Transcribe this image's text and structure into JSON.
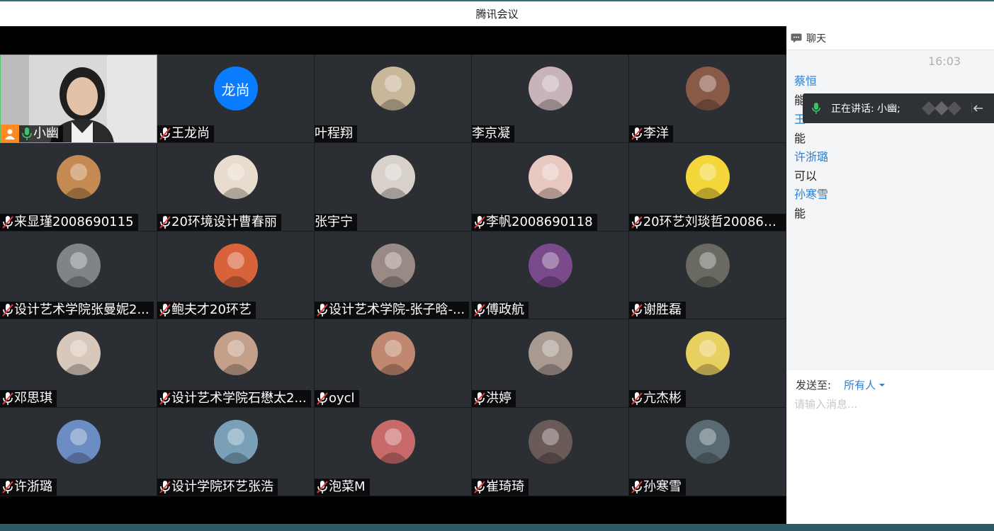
{
  "window": {
    "title": "腾讯会议"
  },
  "participants": [
    {
      "name": "小幽",
      "mic": "on",
      "host": true,
      "video": true
    },
    {
      "name": "王龙尚",
      "mic": "off",
      "avatar_text": "龙尚",
      "avatar_color": "#0a7cff"
    },
    {
      "name": "叶程翔",
      "mic": "none",
      "avatar_color": "#c9b79a"
    },
    {
      "name": "李京凝",
      "mic": "none",
      "avatar_color": "#c8b4b8"
    },
    {
      "name": "李洋",
      "mic": "off",
      "avatar_color": "#8a5a48"
    },
    {
      "name": "来显瑾2008690115",
      "mic": "off",
      "avatar_color": "#c48a52"
    },
    {
      "name": "20环境设计曹春丽",
      "mic": "off",
      "avatar_color": "#e7dccd"
    },
    {
      "name": "张宇宁",
      "mic": "none",
      "avatar_color": "#d8d1ca"
    },
    {
      "name": "李帆2008690118",
      "mic": "off",
      "avatar_color": "#e8c8c0"
    },
    {
      "name": "20环艺刘琰哲200869...",
      "mic": "off",
      "avatar_color": "#f3d63a"
    },
    {
      "name": "设计艺术学院张曼妮2...",
      "mic": "off",
      "avatar_color": "#7f8487"
    },
    {
      "name": "鲍夫才20环艺",
      "mic": "off",
      "avatar_color": "#d8623a"
    },
    {
      "name": "设计艺术学院-张子晗-...",
      "mic": "off",
      "avatar_color": "#9a8a86"
    },
    {
      "name": "傅政航",
      "mic": "off",
      "avatar_color": "#7a4a8c"
    },
    {
      "name": "谢胜磊",
      "mic": "off",
      "avatar_color": "#6a6a62"
    },
    {
      "name": "邓思琪",
      "mic": "off",
      "avatar_color": "#d8c8bc"
    },
    {
      "name": "设计艺术学院石懋太2...",
      "mic": "off",
      "avatar_color": "#c4a08a"
    },
    {
      "name": "oycl",
      "mic": "off",
      "avatar_color": "#c0886e"
    },
    {
      "name": "洪婷",
      "mic": "off",
      "avatar_color": "#a89a90"
    },
    {
      "name": "亢杰彬",
      "mic": "off",
      "avatar_color": "#e8d060"
    },
    {
      "name": "许浙璐",
      "mic": "off",
      "avatar_color": "#6c8cc4"
    },
    {
      "name": "设计学院环艺张浩",
      "mic": "off",
      "avatar_color": "#7aa0b8"
    },
    {
      "name": "泡菜M",
      "mic": "off",
      "avatar_color": "#c86a6a"
    },
    {
      "name": "崔琦琦",
      "mic": "off",
      "avatar_color": "#6a5a58"
    },
    {
      "name": "孙寒雪",
      "mic": "off",
      "avatar_color": "#5a6a72"
    }
  ],
  "chat": {
    "title": "聊天",
    "time": "16:03",
    "messages": [
      {
        "sender": "蔡恒",
        "text": "能"
      },
      {
        "sender": "王",
        "text": "能"
      },
      {
        "sender": "许浙璐",
        "text": "可以"
      },
      {
        "sender": "孙寒雪",
        "text": "能"
      }
    ],
    "speaking": "正在讲话: 小幽;",
    "send_to_label": "发送至:",
    "send_to_value": "所有人",
    "input_placeholder": "请输入消息..."
  }
}
